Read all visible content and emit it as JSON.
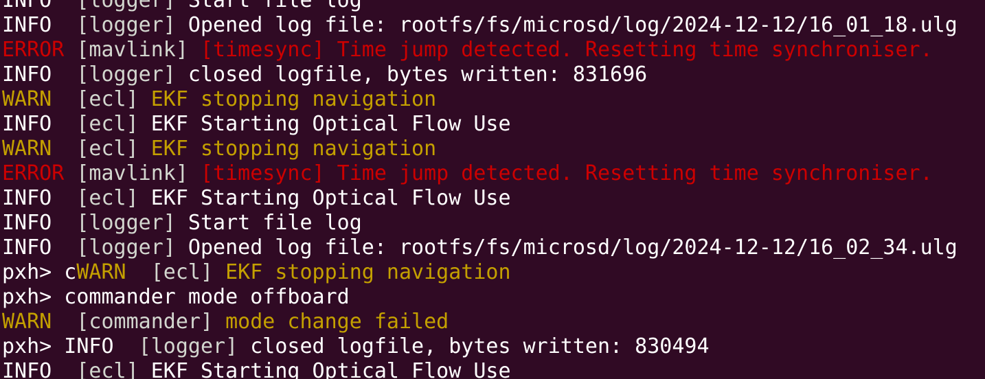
{
  "terminal": {
    "lines": [
      {
        "segments": [
          {
            "text": "INFO  ",
            "color": "#ffffff"
          },
          {
            "text": "[logger]",
            "color": "#d3d7cf"
          },
          {
            "text": " Start file log",
            "color": "#ffffff"
          }
        ]
      },
      {
        "segments": [
          {
            "text": "INFO  ",
            "color": "#ffffff"
          },
          {
            "text": "[logger]",
            "color": "#d3d7cf"
          },
          {
            "text": " Opened log file: rootfs/fs/microsd/log/2024-12-12/16_01_18.ulg",
            "color": "#ffffff"
          }
        ]
      },
      {
        "segments": [
          {
            "text": "ERROR",
            "color": "#cc0000"
          },
          {
            "text": " [mavlink]",
            "color": "#d3d7cf"
          },
          {
            "text": " [timesync] Time jump detected. Resetting time synchroniser.",
            "color": "#cc0000"
          }
        ]
      },
      {
        "segments": [
          {
            "text": "INFO  ",
            "color": "#ffffff"
          },
          {
            "text": "[logger]",
            "color": "#d3d7cf"
          },
          {
            "text": " closed logfile, bytes written: 831696",
            "color": "#ffffff"
          }
        ]
      },
      {
        "segments": [
          {
            "text": "WARN  ",
            "color": "#c4a000"
          },
          {
            "text": "[ecl]",
            "color": "#d3d7cf"
          },
          {
            "text": " EKF stopping navigation",
            "color": "#c4a000"
          }
        ]
      },
      {
        "segments": [
          {
            "text": "INFO  ",
            "color": "#ffffff"
          },
          {
            "text": "[ecl]",
            "color": "#d3d7cf"
          },
          {
            "text": " EKF Starting Optical Flow Use",
            "color": "#ffffff"
          }
        ]
      },
      {
        "segments": [
          {
            "text": "WARN  ",
            "color": "#c4a000"
          },
          {
            "text": "[ecl]",
            "color": "#d3d7cf"
          },
          {
            "text": " EKF stopping navigation",
            "color": "#c4a000"
          }
        ]
      },
      {
        "segments": [
          {
            "text": "ERROR",
            "color": "#cc0000"
          },
          {
            "text": " [mavlink]",
            "color": "#d3d7cf"
          },
          {
            "text": " [timesync] Time jump detected. Resetting time synchroniser.",
            "color": "#cc0000"
          }
        ]
      },
      {
        "segments": [
          {
            "text": "INFO  ",
            "color": "#ffffff"
          },
          {
            "text": "[ecl]",
            "color": "#d3d7cf"
          },
          {
            "text": " EKF Starting Optical Flow Use",
            "color": "#ffffff"
          }
        ]
      },
      {
        "segments": [
          {
            "text": "INFO  ",
            "color": "#ffffff"
          },
          {
            "text": "[logger]",
            "color": "#d3d7cf"
          },
          {
            "text": " Start file log",
            "color": "#ffffff"
          }
        ]
      },
      {
        "segments": [
          {
            "text": "INFO  ",
            "color": "#ffffff"
          },
          {
            "text": "[logger]",
            "color": "#d3d7cf"
          },
          {
            "text": " Opened log file: rootfs/fs/microsd/log/2024-12-12/16_02_34.ulg",
            "color": "#ffffff"
          }
        ]
      },
      {
        "segments": [
          {
            "text": "pxh> c",
            "color": "#ffffff"
          },
          {
            "text": "WARN  ",
            "color": "#c4a000"
          },
          {
            "text": "[ecl]",
            "color": "#d3d7cf"
          },
          {
            "text": " EKF stopping navigation",
            "color": "#c4a000"
          }
        ]
      },
      {
        "segments": [
          {
            "text": "pxh> commander mode offboard",
            "color": "#ffffff"
          }
        ]
      },
      {
        "segments": [
          {
            "text": "WARN  ",
            "color": "#c4a000"
          },
          {
            "text": "[commander]",
            "color": "#d3d7cf"
          },
          {
            "text": " mode change failed",
            "color": "#c4a000"
          }
        ]
      },
      {
        "segments": [
          {
            "text": "pxh> INFO  ",
            "color": "#ffffff"
          },
          {
            "text": "[logger]",
            "color": "#d3d7cf"
          },
          {
            "text": " closed logfile, bytes written: 830494",
            "color": "#ffffff"
          }
        ]
      },
      {
        "segments": [
          {
            "text": "INFO  ",
            "color": "#ffffff"
          },
          {
            "text": "[ecl]",
            "color": "#d3d7cf"
          },
          {
            "text": " EKF Starting Optical Flow Use",
            "color": "#ffffff"
          }
        ]
      }
    ]
  }
}
